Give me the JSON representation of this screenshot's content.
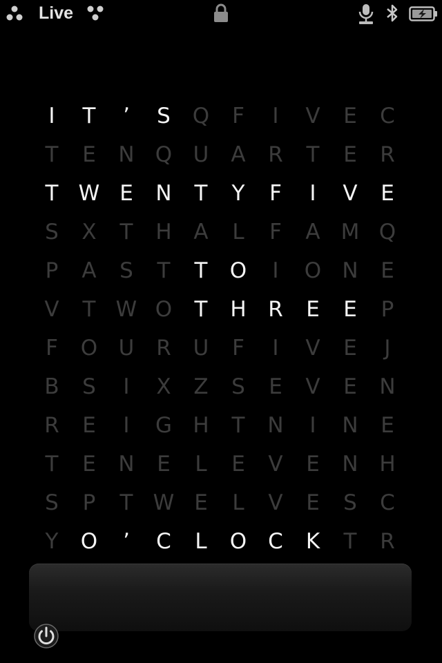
{
  "status_bar": {
    "carrier": "Live",
    "left_icon": "carrier-dots-icon",
    "right_icon": "carrier-dots-icon",
    "lock_icon": "lock-icon",
    "mic_icon": "microphone-icon",
    "bluetooth_icon": "bluetooth-icon",
    "battery_icon": "battery-charging-icon"
  },
  "word_clock": {
    "active_color": "#f5f5f5",
    "inactive_color": "#3c3c3c",
    "rows": [
      {
        "letters": [
          "I",
          "T",
          "’",
          "S",
          "Q",
          "F",
          "I",
          "V",
          "E",
          "C"
        ],
        "on": [
          1,
          1,
          1,
          1,
          0,
          0,
          0,
          0,
          0,
          0
        ]
      },
      {
        "letters": [
          "T",
          "E",
          "N",
          "Q",
          "U",
          "A",
          "R",
          "T",
          "E",
          "R"
        ],
        "on": [
          0,
          0,
          0,
          0,
          0,
          0,
          0,
          0,
          0,
          0
        ]
      },
      {
        "letters": [
          "T",
          "W",
          "E",
          "N",
          "T",
          "Y",
          "F",
          "I",
          "V",
          "E"
        ],
        "on": [
          1,
          1,
          1,
          1,
          1,
          1,
          1,
          1,
          1,
          1
        ]
      },
      {
        "letters": [
          "S",
          "X",
          "T",
          "H",
          "A",
          "L",
          "F",
          "A",
          "M",
          "Q"
        ],
        "on": [
          0,
          0,
          0,
          0,
          0,
          0,
          0,
          0,
          0,
          0
        ]
      },
      {
        "letters": [
          "P",
          "A",
          "S",
          "T",
          "T",
          "O",
          "I",
          "O",
          "N",
          "E"
        ],
        "on": [
          0,
          0,
          0,
          0,
          1,
          1,
          0,
          0,
          0,
          0
        ]
      },
      {
        "letters": [
          "V",
          "T",
          "W",
          "O",
          "T",
          "H",
          "R",
          "E",
          "E",
          "P"
        ],
        "on": [
          0,
          0,
          0,
          0,
          1,
          1,
          1,
          1,
          1,
          0
        ]
      },
      {
        "letters": [
          "F",
          "O",
          "U",
          "R",
          "U",
          "F",
          "I",
          "V",
          "E",
          "J"
        ],
        "on": [
          0,
          0,
          0,
          0,
          0,
          0,
          0,
          0,
          0,
          0
        ]
      },
      {
        "letters": [
          "B",
          "S",
          "I",
          "X",
          "Z",
          "S",
          "E",
          "V",
          "E",
          "N"
        ],
        "on": [
          0,
          0,
          0,
          0,
          0,
          0,
          0,
          0,
          0,
          0
        ]
      },
      {
        "letters": [
          "R",
          "E",
          "I",
          "G",
          "H",
          "T",
          "N",
          "I",
          "N",
          "E"
        ],
        "on": [
          0,
          0,
          0,
          0,
          0,
          0,
          0,
          0,
          0,
          0
        ]
      },
      {
        "letters": [
          "T",
          "E",
          "N",
          "E",
          "L",
          "E",
          "V",
          "E",
          "N",
          "H"
        ],
        "on": [
          0,
          0,
          0,
          0,
          0,
          0,
          0,
          0,
          0,
          0
        ]
      },
      {
        "letters": [
          "S",
          "P",
          "T",
          "W",
          "E",
          "L",
          "V",
          "E",
          "S",
          "C"
        ],
        "on": [
          0,
          0,
          0,
          0,
          0,
          0,
          0,
          0,
          0,
          0
        ]
      },
      {
        "letters": [
          "Y",
          "O",
          "’",
          "C",
          "L",
          "O",
          "C",
          "K",
          "T",
          "R"
        ],
        "on": [
          0,
          1,
          1,
          1,
          1,
          1,
          1,
          1,
          0,
          0
        ]
      }
    ]
  },
  "controls": {
    "power_icon": "power-icon"
  }
}
